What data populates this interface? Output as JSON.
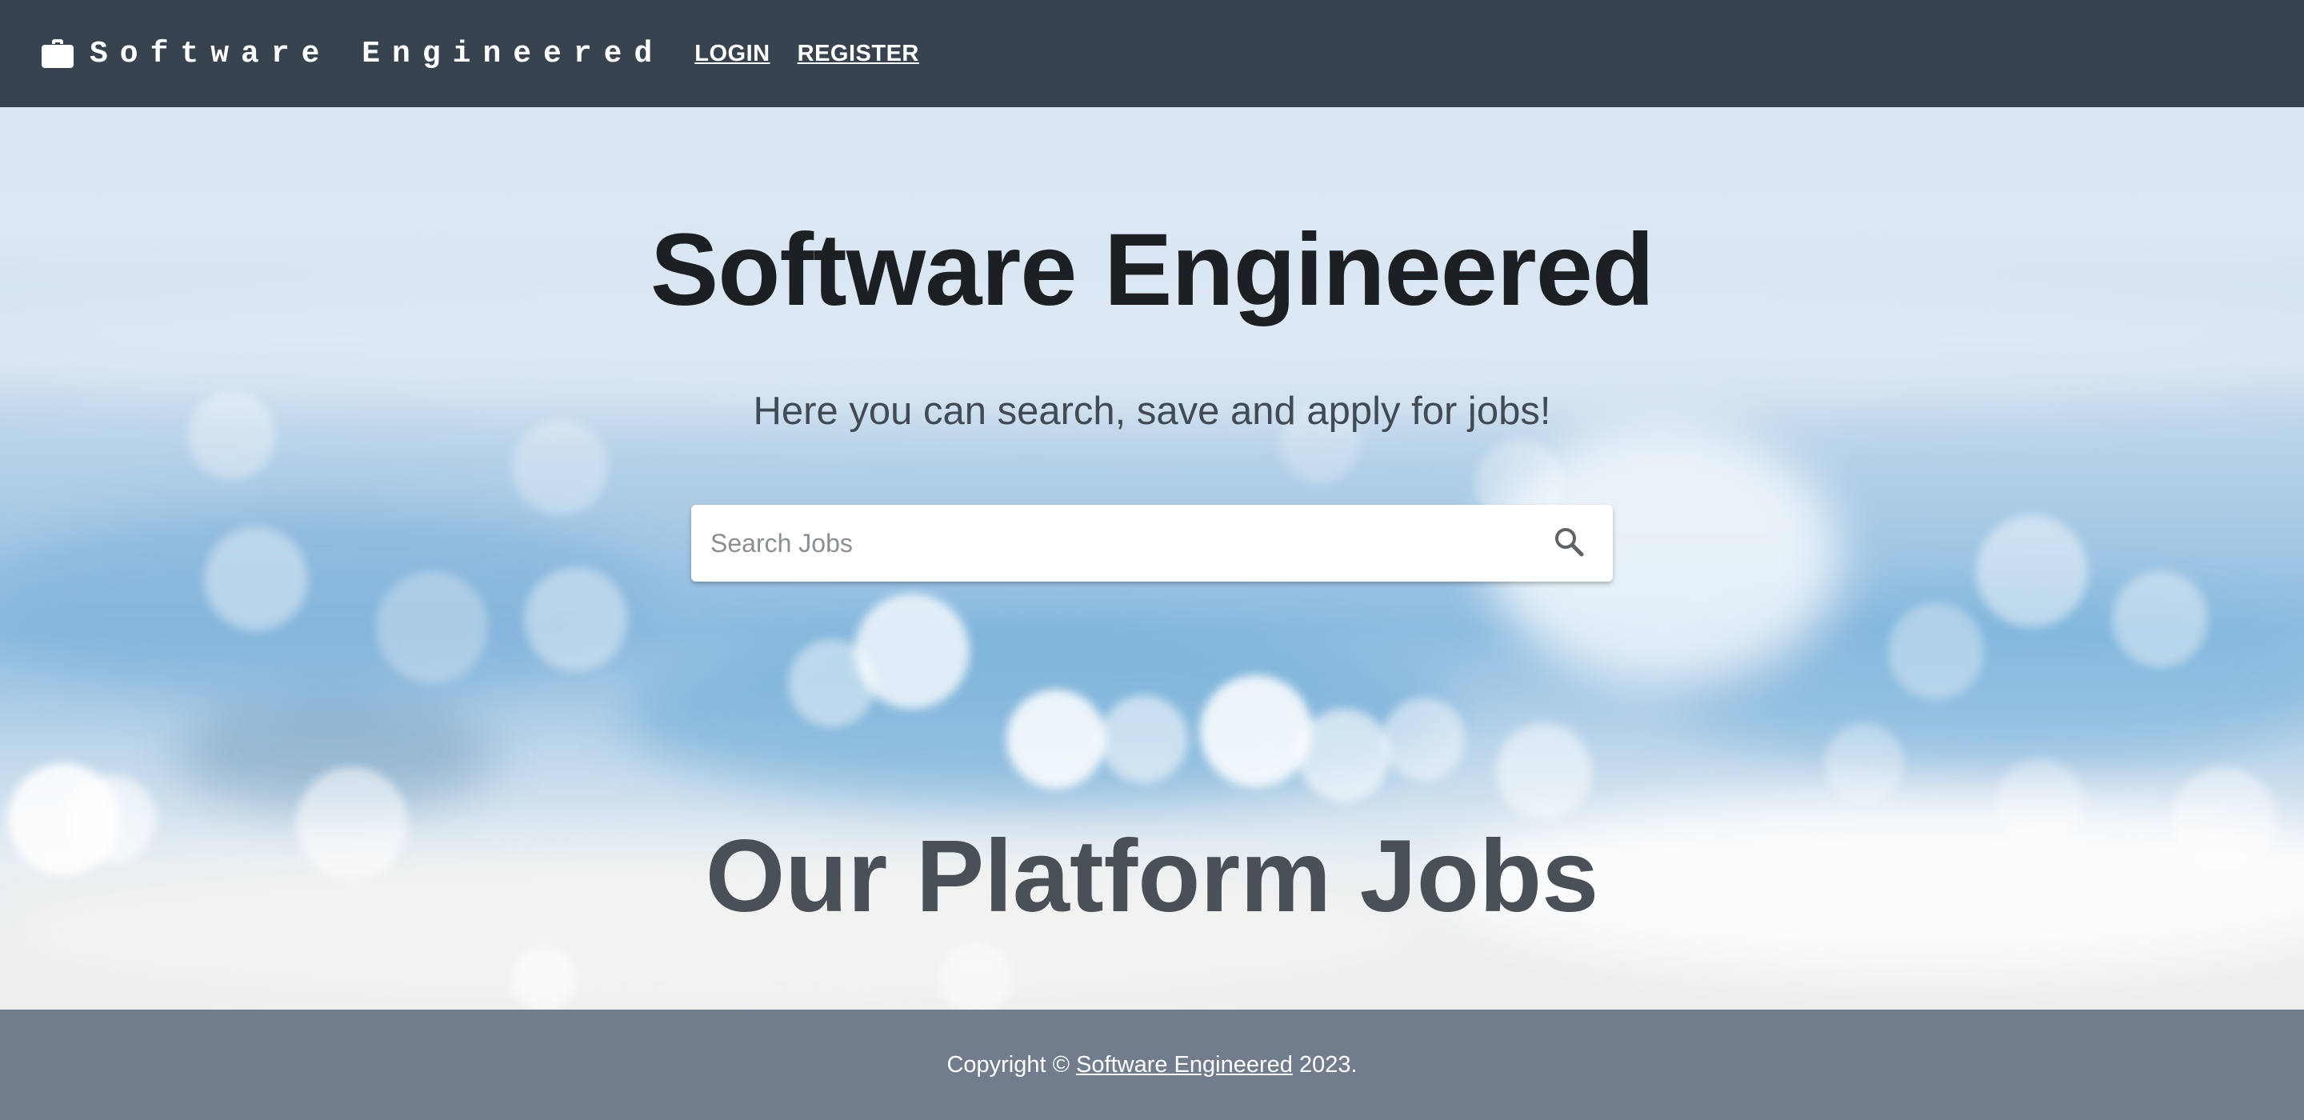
{
  "header": {
    "brand": "Software Engineered",
    "nav": {
      "login": "LOGIN",
      "register": "REGISTER"
    }
  },
  "hero": {
    "title": "Software Engineered",
    "subtitle": "Here you can search, save and apply for jobs!",
    "search": {
      "placeholder": "Search Jobs",
      "value": ""
    },
    "section_title": "Our Platform Jobs"
  },
  "footer": {
    "prefix": "Copyright ©",
    "link": "Software Engineered",
    "suffix": "2023."
  },
  "icons": {
    "brand": "briefcase-icon",
    "search": "search-icon"
  },
  "colors": {
    "header_bg": "#37434e",
    "footer_bg": "#717d8d",
    "title_text": "#1d2023",
    "section_title_text": "#4a5058"
  }
}
